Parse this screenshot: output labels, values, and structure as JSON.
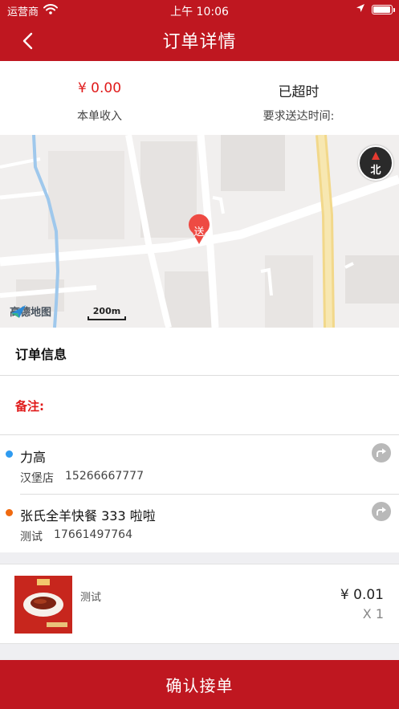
{
  "status_bar": {
    "carrier": "运营商",
    "time": "上午 10:06"
  },
  "nav": {
    "title": "订单详情"
  },
  "summary": {
    "income_value": "¥ 0.00",
    "income_label": "本单收入",
    "deadline_value": "已超时",
    "deadline_label": "要求送达时间:"
  },
  "map": {
    "marker_label": "送",
    "compass_label": "北",
    "provider": "高德地图",
    "scale": "200m"
  },
  "order_info": {
    "title": "订单信息",
    "note_label": "备注:"
  },
  "pickup": {
    "name": "力高",
    "contact": "汉堡店",
    "phone": "15266667777",
    "dot_color": "#2f9bf0"
  },
  "dropoff": {
    "name": "张氏全羊快餐 333 啦啦",
    "contact": "测试",
    "phone": "17661497764",
    "dot_color": "#f06a10"
  },
  "goods": {
    "name": "测试",
    "price": "¥ 0.01",
    "qty": "X 1"
  },
  "confirm_button": "确认接单",
  "colors": {
    "brand": "#bf1720",
    "accent_red": "#e01b1b"
  }
}
